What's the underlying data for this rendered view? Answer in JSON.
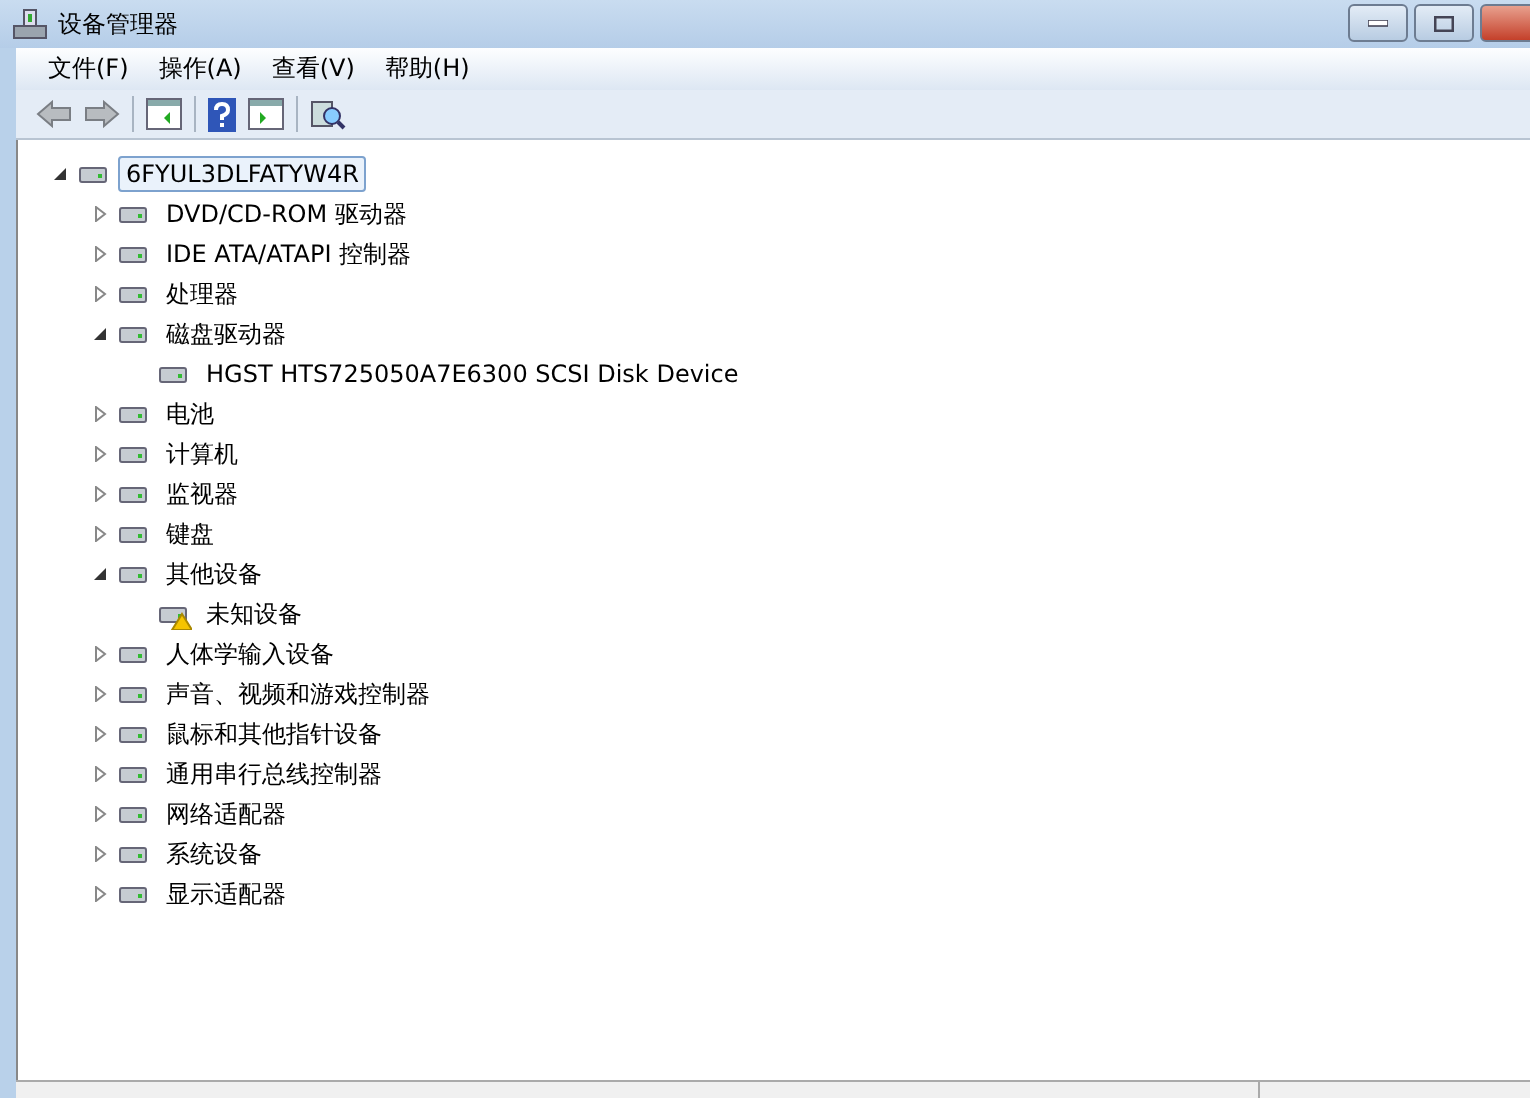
{
  "window": {
    "title": "设备管理器"
  },
  "menu": [
    {
      "label": "文件(F)"
    },
    {
      "label": "操作(A)"
    },
    {
      "label": "查看(V)"
    },
    {
      "label": "帮助(H)"
    }
  ],
  "tree": {
    "label": "6FYUL3DLFATYW4R",
    "expanded": true,
    "selected": true,
    "children": [
      {
        "label": "DVD/CD-ROM 驱动器",
        "expanded": false,
        "selected": false
      },
      {
        "label": "IDE ATA/ATAPI 控制器",
        "expanded": false,
        "selected": false
      },
      {
        "label": "处理器",
        "expanded": false,
        "selected": false
      },
      {
        "label": "磁盘驱动器",
        "expanded": true,
        "selected": false,
        "children": [
          {
            "label": "HGST HTS725050A7E6300 SCSI Disk Device",
            "selected": false,
            "warning": false
          }
        ]
      },
      {
        "label": "电池",
        "expanded": false,
        "selected": false
      },
      {
        "label": "计算机",
        "expanded": false,
        "selected": false
      },
      {
        "label": "监视器",
        "expanded": false,
        "selected": false
      },
      {
        "label": "键盘",
        "expanded": false,
        "selected": false
      },
      {
        "label": "其他设备",
        "expanded": true,
        "selected": false,
        "children": [
          {
            "label": "未知设备",
            "selected": false,
            "warning": true
          }
        ]
      },
      {
        "label": "人体学输入设备",
        "expanded": false,
        "selected": false
      },
      {
        "label": "声音、视频和游戏控制器",
        "expanded": false,
        "selected": false
      },
      {
        "label": "鼠标和其他指针设备",
        "expanded": false,
        "selected": false
      },
      {
        "label": "通用串行总线控制器",
        "expanded": false,
        "selected": false
      },
      {
        "label": "网络适配器",
        "expanded": false,
        "selected": false
      },
      {
        "label": "系统设备",
        "expanded": false,
        "selected": false
      },
      {
        "label": "显示适配器",
        "expanded": false,
        "selected": false
      }
    ]
  }
}
